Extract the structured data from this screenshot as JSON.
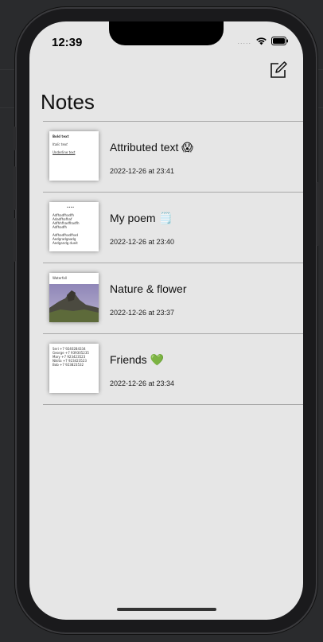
{
  "status_bar": {
    "time": "12:39",
    "signal": "....."
  },
  "header": {
    "title": "Notes"
  },
  "notes": [
    {
      "title": "Attributed text 😱",
      "date": "2022-12-26 at 23:41",
      "thumb_type": "text",
      "thumb_lines": [
        "Bold text",
        "",
        "Italic text",
        "",
        "Underline text"
      ]
    },
    {
      "title": "My poem 🗒️",
      "date": "2022-12-26 at 23:40",
      "thumb_type": "text",
      "thumb_lines": [
        "              ••••",
        "",
        "Adfhadfhadfh",
        "Adadfhafhaf",
        "Adfhhfhadfhadfh",
        "Adfhadfh",
        "",
        "Adfhadfhadfhad",
        "Aedgradgaadg",
        "Aedgandg dueit"
      ]
    },
    {
      "title": "Nature & flower",
      "date": "2022-12-26 at 23:37",
      "thumb_type": "image",
      "thumb_lines": [
        "Waterfall"
      ]
    },
    {
      "title": "Friends 💚",
      "date": "2022-12-26 at 23:34",
      "thumb_type": "text",
      "thumb_lines": [
        "Seri +7 9240284334",
        "George +7 939305235",
        "Mary +7 923423523",
        "Nikita +7 923423523",
        "Bob +7 923823532"
      ]
    }
  ]
}
